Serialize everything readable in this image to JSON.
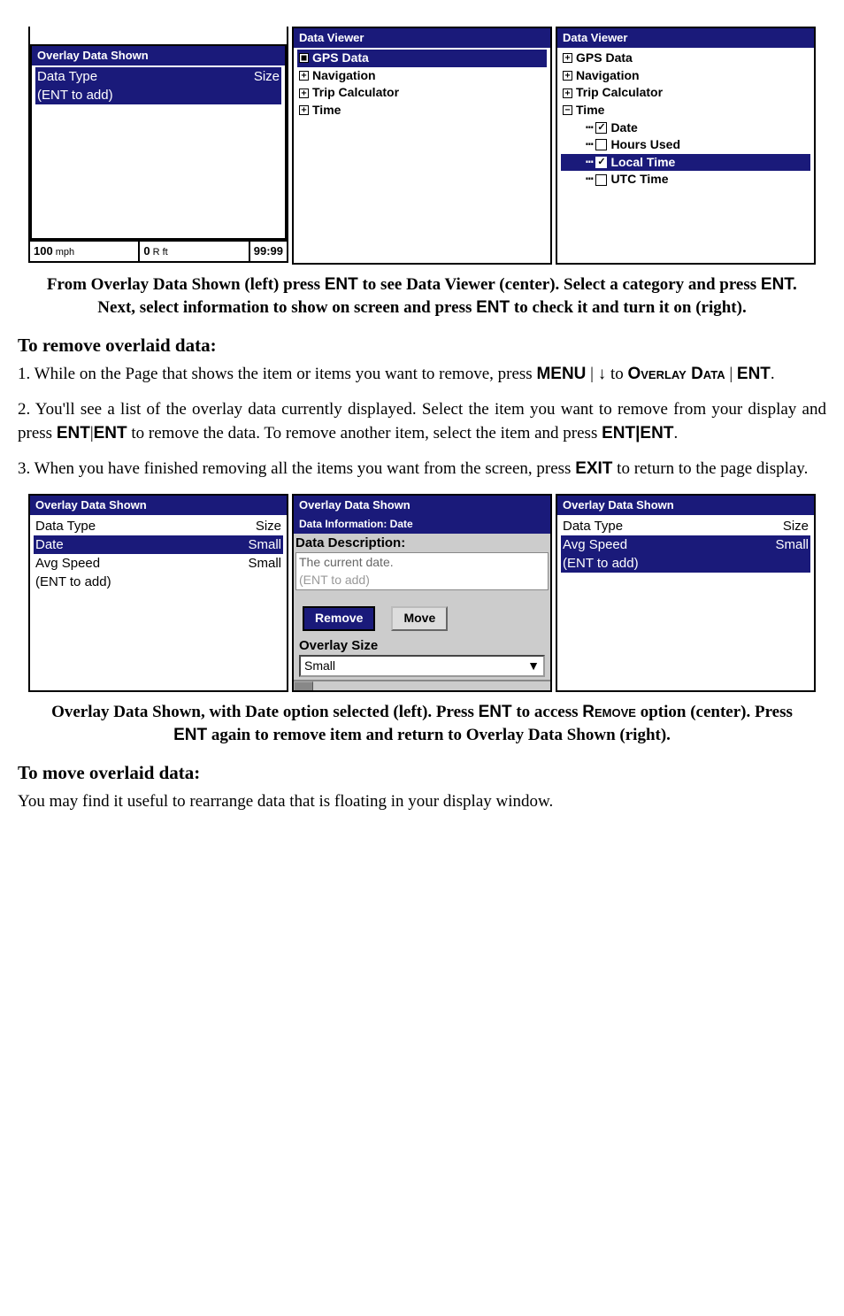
{
  "fig1": {
    "left": {
      "title": "Overlay Data Shown",
      "rows": [
        {
          "label": "Data Type",
          "size": "Size",
          "sel": true
        },
        {
          "label": "(ENT to add)",
          "size": "",
          "sel": true
        }
      ],
      "status": [
        {
          "val": "100",
          "unit": "mph"
        },
        {
          "val": "0",
          "unit": "R ft"
        },
        {
          "val": "99:99",
          "unit": ""
        }
      ]
    },
    "center": {
      "title": "Data Viewer",
      "tree": [
        {
          "glyph": "■",
          "label": "GPS Data",
          "sel": true
        },
        {
          "glyph": "+",
          "label": "Navigation"
        },
        {
          "glyph": "+",
          "label": "Trip Calculator"
        },
        {
          "glyph": "+",
          "label": "Time"
        }
      ]
    },
    "right": {
      "title": "Data Viewer",
      "tree": [
        {
          "glyph": "+",
          "label": "GPS Data"
        },
        {
          "glyph": "+",
          "label": "Navigation"
        },
        {
          "glyph": "+",
          "label": "Trip Calculator"
        },
        {
          "glyph": "−",
          "label": "Time"
        }
      ],
      "children": [
        {
          "checked": true,
          "label": "Date"
        },
        {
          "checked": false,
          "label": "Hours Used"
        },
        {
          "checked": true,
          "label": "Local Time",
          "sel": true
        },
        {
          "checked": false,
          "label": "UTC Time"
        }
      ]
    }
  },
  "caption1": "From Overlay Data Shown (left) press ENT to see Data Viewer (center). Select a category and press ENT. Next, select information to show on screen and press ENT to check it and turn it on (right).",
  "section1_heading": "To remove overlaid data:",
  "section1_p1a": "1. While on the Page that shows the item or items you want to remove, press ",
  "section1_p1b": "MENU",
  "section1_p1c": " | ↓ to ",
  "section1_p1d": "Overlay Data",
  "section1_p1e": " | ",
  "section1_p1f": "ENT",
  "section1_p1g": ".",
  "section1_p2": "2. You'll see a list of the overlay data currently displayed. Select the item you want to remove from your display and press ENT|ENT to remove the data. To remove another item, select the item and press ENT|ENT.",
  "section1_p3": "3. When you have finished removing all the items you want from the screen, press EXIT to return to the page display.",
  "fig2": {
    "left": {
      "title": "Overlay Data Shown",
      "rows": [
        {
          "label": "Data Type",
          "size": "Size",
          "header": true
        },
        {
          "label": "Date",
          "size": "Small",
          "sel": true
        },
        {
          "label": "Avg Speed",
          "size": "Small"
        },
        {
          "label": "(ENT to add)",
          "size": ""
        }
      ]
    },
    "center": {
      "title": "Overlay Data Shown",
      "subtitle": "Data Information: Date",
      "desc_label": "Data Description:",
      "desc_text": "The current date.",
      "ghost": "(ENT to add)",
      "btn_remove": "Remove",
      "btn_move": "Move",
      "overlay_size_label": "Overlay Size",
      "overlay_size_value": "Small"
    },
    "right": {
      "title": "Overlay Data Shown",
      "rows": [
        {
          "label": "Data Type",
          "size": "Size",
          "header": true
        },
        {
          "label": "Avg Speed",
          "size": "Small",
          "sel": true
        },
        {
          "label": "(ENT to add)",
          "size": "",
          "sel": true
        }
      ]
    }
  },
  "caption2": "Overlay Data Shown, with Date option selected (left). Press ENT to access Remove option (center). Press ENT again to remove item and return to Overlay Data Shown (right).",
  "section2_heading": "To move overlaid data:",
  "section2_p1": "You may find it useful to rearrange data that is floating in your display window."
}
